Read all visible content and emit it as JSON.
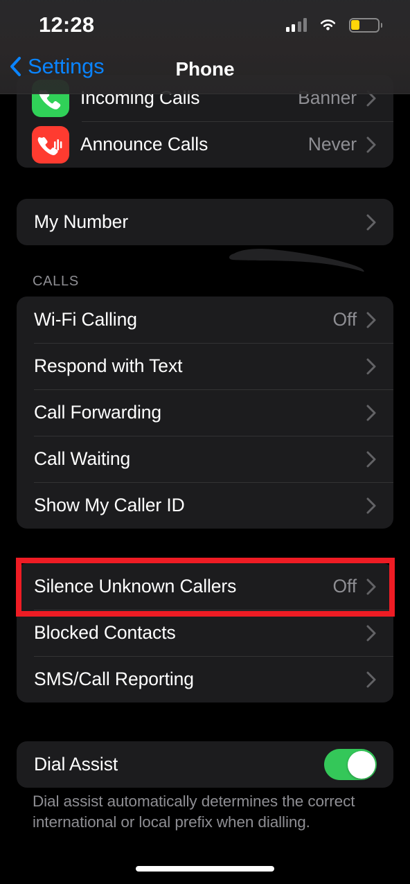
{
  "status_bar": {
    "time": "12:28",
    "cellular_icon": "cellular-bars-icon",
    "cellular_bars_filled": 2,
    "cellular_bars_total": 4,
    "wifi_icon": "wifi-icon",
    "battery_icon": "battery-low-power-icon",
    "battery_fill_color": "#ffd60a",
    "battery_level_percent": 30
  },
  "nav_bar": {
    "back_label": "Settings",
    "back_icon": "chevron-left-icon",
    "title": "Phone",
    "accent_color": "#0a84ff"
  },
  "sections": {
    "announce": {
      "rows": [
        {
          "label": "Incoming Calls",
          "value": "Banner",
          "icon": "phone-incoming-call-icon",
          "icon_color": "#30d158"
        },
        {
          "label": "Announce Calls",
          "value": "Never",
          "icon": "announce-calls-icon",
          "icon_color": "#ff3b30"
        }
      ]
    },
    "my_number": {
      "rows": [
        {
          "label": "My Number",
          "value": ""
        }
      ]
    },
    "calls": {
      "header": "CALLS",
      "rows": [
        {
          "label": "Wi-Fi Calling",
          "value": "Off"
        },
        {
          "label": "Respond with Text",
          "value": ""
        },
        {
          "label": "Call Forwarding",
          "value": ""
        },
        {
          "label": "Call Waiting",
          "value": ""
        },
        {
          "label": "Show My Caller ID",
          "value": ""
        }
      ]
    },
    "blocking": {
      "rows": [
        {
          "label": "Silence Unknown Callers",
          "value": "Off"
        },
        {
          "label": "Blocked Contacts",
          "value": ""
        },
        {
          "label": "SMS/Call Reporting",
          "value": ""
        }
      ]
    },
    "dial_assist": {
      "rows": [
        {
          "label": "Dial Assist",
          "toggle": "on",
          "toggle_color": "#34c759"
        }
      ],
      "footer": "Dial assist automatically determines the correct international or local prefix when dialling."
    }
  },
  "annotations": {
    "highlight_color": "#ee1c24",
    "highlight_target": "Silence Unknown Callers",
    "redaction_color": "#222224",
    "redaction_target": "My Number"
  },
  "home_indicator": "home-indicator"
}
